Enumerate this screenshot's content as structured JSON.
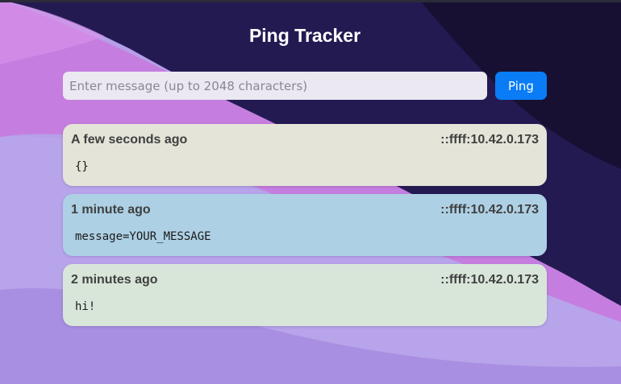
{
  "app": {
    "title": "Ping Tracker"
  },
  "form": {
    "input_value": "",
    "input_placeholder": "Enter message (up to 2048 characters)",
    "button_label": "Ping",
    "button_color": "#0a7cf5"
  },
  "pings": [
    {
      "time": "A few seconds ago",
      "ip": "::ffff:10.42.0.173",
      "message": "{}",
      "color": "#e4e4d8"
    },
    {
      "time": "1 minute ago",
      "ip": "::ffff:10.42.0.173",
      "message": "message=YOUR_MESSAGE",
      "color": "#add0e4"
    },
    {
      "time": "2 minutes ago",
      "ip": "::ffff:10.42.0.173",
      "message": "hi!",
      "color": "#d8e6da"
    }
  ]
}
